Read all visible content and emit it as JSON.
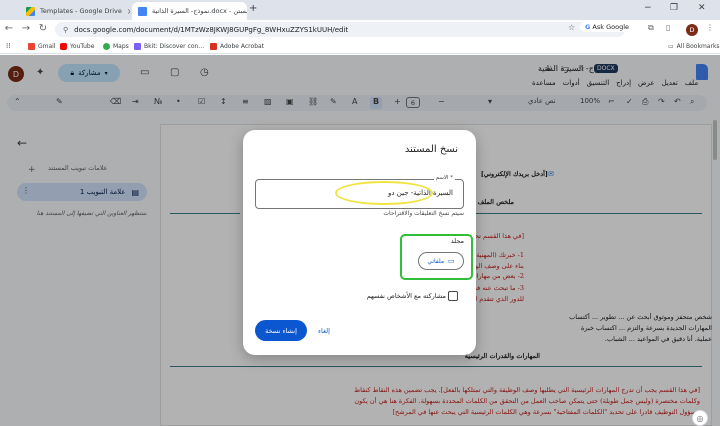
{
  "browser": {
    "tabs": [
      {
        "title": "Templates - Google Drive",
        "close": "×"
      },
      {
        "title": "نموذج- السيرة الذاتية.docx - مستن…",
        "close": "×"
      }
    ],
    "new_tab": "+",
    "window_controls": [
      "−",
      "❐",
      "✕"
    ],
    "url": "docs.google.com/document/d/1MTzWz8JKWJ8GUPgFg_8WHxuZZYS1kUUH/edit",
    "ask_google": "Ask Google",
    "profile_initial": "D",
    "bookmarks": [
      "Gmail",
      "YouTube",
      "Maps",
      "Bkit: Discover con…",
      "Adobe Acrobat"
    ],
    "all_bookmarks": "All Bookmarks"
  },
  "docs": {
    "title": "نموذج- السيرة الذاتية",
    "badge": "DOCX",
    "menu": [
      "ملف",
      "تعديل",
      "عرض",
      "إدراج",
      "التنسيق",
      "أدوات",
      "مساعدة"
    ],
    "avatar_initial": "D",
    "share_label": "مشاركة",
    "toolbar": {
      "zoom": "100%",
      "style": "نص عادي",
      "font_size": "6",
      "bold": "B"
    }
  },
  "outline": {
    "heading": "علامات تبويب المستند",
    "tab_label": "علامة التبويب 1",
    "hint": "ستظهر العناوين التي تضيفها إلى المستند هنا."
  },
  "document": {
    "email_placeholder": "[أدخل بريدك الإلكتروني]",
    "section_summary": "ملخص الملف الشخصي",
    "summary_prompt": "[في هذا القسم تحتاج إلى كتابة ملخ...]",
    "list_items": [
      "1-  خبرتك (المهنية والتعليمية)...",
      "2-  بعض من مهاراتك التي...",
      "3-  ما تبحث عنه في مسيرتك..."
    ],
    "list_tail": "بناء على وصف الوظيفة.",
    "role_line": "للدور الذي تتقدم له].",
    "paragraph": [
      "شخص متحفز وموثوق أبحث عن ... تطوير ... أكتساب",
      "المهارات الجديدة بسرعة والتزم ... اكتساب خبرة",
      "عملية. أنا دقيق في المواعيد ... الشباب."
    ],
    "section_skills": "المهارات والقدرات الرئيسية",
    "skills_prompt": [
      "[في هذا القسم يجب أن تدرج المهارات الرئيسية التي يطلبها وصف الوظيفة والتي تمتلكها بالفعل]. يجب تضمين هذه النقاط كنقاط",
      "وكلمات مختصرة (وليس جمل طويلة) حتى يتمكن صاحب العمل من التحقق من الكلمات المحددة بسهولة. الفكرة هنا هي أن يكون",
      "مسؤول التوظيف قادرا على تحديد \"الكلمات المفتاحية\" بسرعة وهي الكلمات الرئيسية التي يبحث عنها في المرشح]"
    ]
  },
  "dialog": {
    "title": "نسخ المستند",
    "name_legend": "الاسم *",
    "name_value": "السيرة الذاتية- جين دو",
    "name_hint": "سيتم نسخ التعليقات والاقتراحات",
    "folder_label": "مجلد",
    "folder_value": "ملفاتي",
    "share_checkbox_label": "مشاركته مع الأشخاص نفسهم",
    "share_checked": false,
    "cancel_label": "إلغاء",
    "copy_label": "إنشاء نسخة"
  },
  "colors": {
    "primary": "#0b57d0",
    "highlight_yellow": "#f0e442",
    "highlight_green": "#2fbf3a"
  }
}
